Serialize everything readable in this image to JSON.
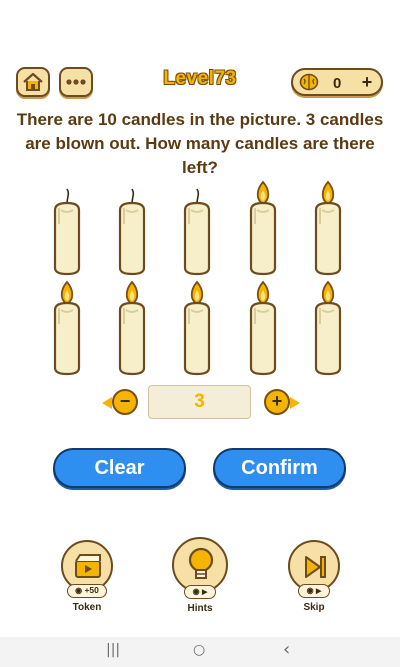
{
  "header": {
    "home_icon": "home-icon",
    "menu_icon": "more-dots-icon",
    "level_title": "Level73",
    "token_icon": "brain-icon",
    "token_count": "0",
    "add_tokens_label": "+"
  },
  "puzzle": {
    "question": "There are 10 candles in the picture. 3 candles are blown out. How many candles are there left?",
    "candles": [
      {
        "lit": false
      },
      {
        "lit": false
      },
      {
        "lit": false
      },
      {
        "lit": true
      },
      {
        "lit": true
      },
      {
        "lit": true
      },
      {
        "lit": true
      },
      {
        "lit": true
      },
      {
        "lit": true
      },
      {
        "lit": true
      }
    ]
  },
  "answer": {
    "minus_label": "−",
    "value": "3",
    "plus_label": "+"
  },
  "actions": {
    "clear_label": "Clear",
    "confirm_label": "Confirm"
  },
  "bottom_bar": {
    "token": {
      "label": "Token",
      "badge": "+50",
      "icon": "video-clapper-icon"
    },
    "hints": {
      "label": "Hints",
      "icon": "lightbulb-icon"
    },
    "skip": {
      "label": "Skip",
      "icon": "skip-forward-icon"
    }
  },
  "system_nav": {
    "recents": "|||",
    "home": "○",
    "back": "‹"
  },
  "colors": {
    "accent_yellow": "#f5b400",
    "button_blue": "#2f8ff0",
    "text_brown": "#5a3b12",
    "panel_cream": "#f6e0a6"
  }
}
